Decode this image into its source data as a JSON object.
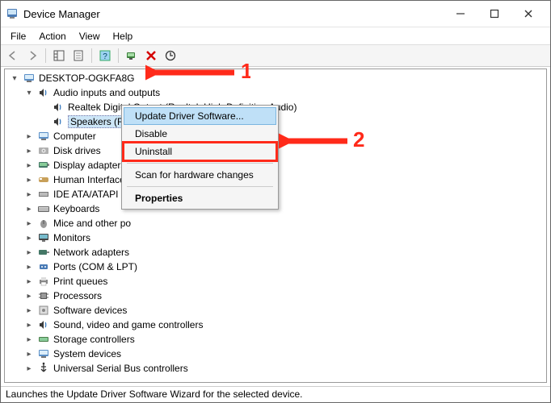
{
  "window": {
    "title": "Device Manager"
  },
  "menubar": {
    "file": "File",
    "action": "Action",
    "view": "View",
    "help": "Help"
  },
  "tree": {
    "root": "DESKTOP-OGKFA8G",
    "audio": {
      "label": "Audio inputs and outputs",
      "children": {
        "realtek_digital": "Realtek Digital Output (Realtek High Definition Audio)",
        "speakers": "Speakers (Realtek High Definition Audio)"
      }
    },
    "computer": "Computer",
    "disk_drives": "Disk drives",
    "display_adapters": "Display adapters",
    "human_interface": "Human Interface",
    "ide_ata": "IDE ATA/ATAPI co",
    "keyboards": "Keyboards",
    "mice": "Mice and other po",
    "monitors": "Monitors",
    "network_adapters": "Network adapters",
    "ports": "Ports (COM & LPT)",
    "print_queues": "Print queues",
    "processors": "Processors",
    "software_devices": "Software devices",
    "sound_video_game": "Sound, video and game controllers",
    "storage_controllers": "Storage controllers",
    "system_devices": "System devices",
    "usb_controllers": "Universal Serial Bus controllers"
  },
  "context_menu": {
    "update_driver": "Update Driver Software...",
    "disable": "Disable",
    "uninstall": "Uninstall",
    "scan": "Scan for hardware changes",
    "properties": "Properties"
  },
  "statusbar": {
    "text": "Launches the Update Driver Software Wizard for the selected device."
  },
  "annotations": {
    "one": "1",
    "two": "2"
  }
}
